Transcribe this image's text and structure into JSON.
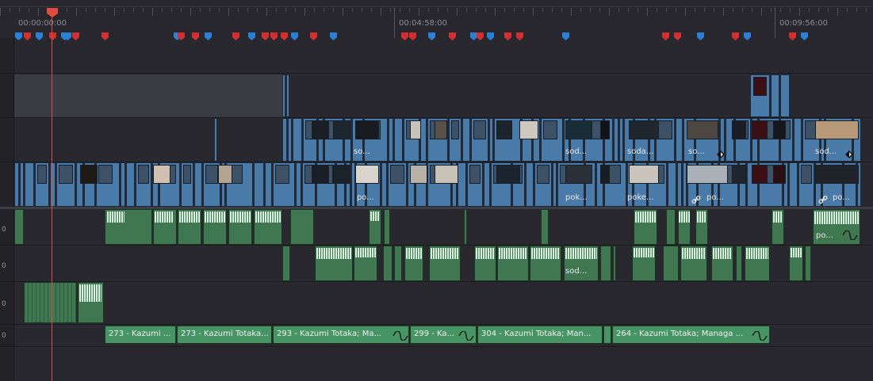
{
  "ruler": {
    "timecodes": [
      "00:00:00:00",
      "00:04:58:00",
      "00:09:56:00"
    ]
  },
  "markers": {
    "colors": {
      "blue": "#2b7fd6",
      "red": "#d42f2f"
    },
    "sequence": [
      "blue",
      "red",
      "blue",
      "red",
      "blue",
      "blue",
      "red",
      "red",
      "blue",
      "red",
      "red",
      "blue",
      "red",
      "blue",
      "red",
      "red",
      "red",
      "blue",
      "red",
      "blue",
      "red",
      "red",
      "blue",
      "red",
      "blue",
      "red",
      "blue",
      "red",
      "red",
      "blue",
      "red",
      "red"
    ]
  },
  "track_numbers": [
    "0",
    "0",
    "0",
    "0"
  ],
  "video_clips": {
    "v1_labels": [
      "so...",
      "sod...",
      "soda...",
      "so...",
      "sod..."
    ],
    "v2_labels": [
      "po...",
      "pok...",
      "poke...",
      "po...",
      "po..."
    ]
  },
  "audio_clips": {
    "a1_label": "po...",
    "a2_label": "sod..."
  },
  "music_clips": [
    "273 - Kazumi ...",
    "273 - Kazumi Totaka...",
    "293 - Kazumi Totaka; Ma...",
    "299 - Ka...",
    "304 - Kazumi Totaka; Man...",
    "264 - Kazumi Totaka; Managa ..."
  ],
  "colors": {
    "video_clip": "#4a7aa8",
    "audio_clip": "#3f7751",
    "music_pill": "#479464",
    "playhead": "#e14a42"
  },
  "playhead_timecode": "00:00:00:00"
}
